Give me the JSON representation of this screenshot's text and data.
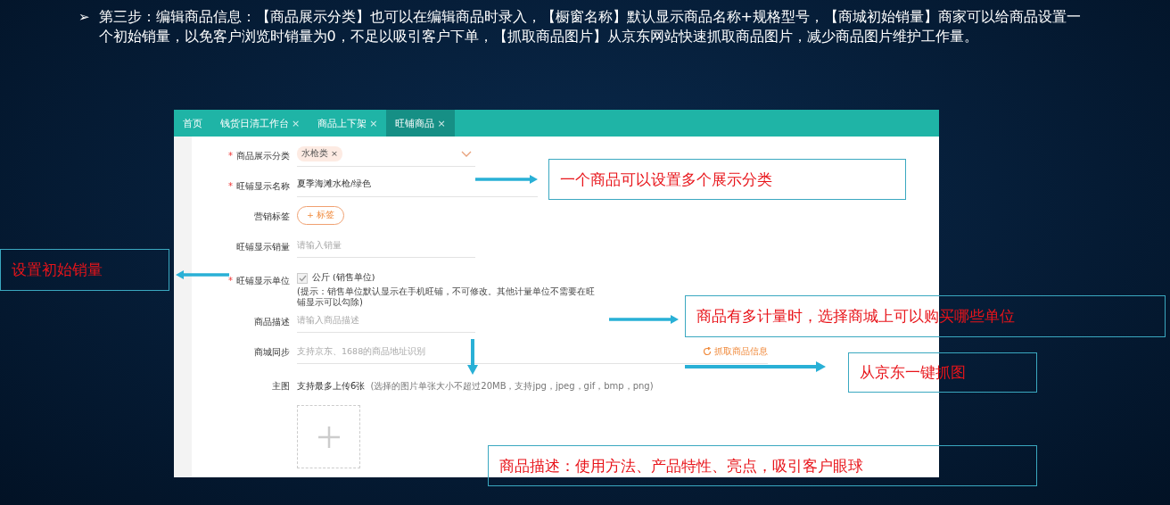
{
  "slide": {
    "bullet": "➢",
    "text": "第三步：编辑商品信息：【商品展示分类】也可以在编辑商品时录入，【橱窗名称】默认显示商品名称+规格型号，【商城初始销量】商家可以给商品设置一个初始销量，以免客户浏览时销量为0，不足以吸引客户下单，【抓取商品图片】从京东网站快速抓取商品图片，减少商品图片维护工作量。"
  },
  "app": {
    "tabs": [
      {
        "label": "首页",
        "selected": false
      },
      {
        "label": "钱货日清工作台",
        "close": "×",
        "selected": false
      },
      {
        "label": "商品上下架",
        "close": "×",
        "selected": false
      },
      {
        "label": "旺铺商品",
        "close": "×",
        "selected": true
      }
    ],
    "required_mark": "*",
    "form": [
      {
        "kind": "tag-select",
        "label": "商品展示分类",
        "required": true,
        "tag": "水枪类",
        "tag_close": "×"
      },
      {
        "kind": "text",
        "label": "旺铺显示名称",
        "required": true,
        "value": "夏季海滩水枪/绿色"
      },
      {
        "kind": "tag-button",
        "label": "营销标签",
        "required": false,
        "button": "+ 标签"
      },
      {
        "kind": "input",
        "label": "旺铺显示销量",
        "required": false,
        "placeholder": "请输入销量"
      },
      {
        "kind": "checkbox",
        "label": "旺铺显示单位",
        "required": true,
        "option": "公斤 (销售单位)",
        "checked": true,
        "hint": "(提示：销售单位默认显示在手机旺铺，不可修改。其他计量单位不需要在旺铺显示可以勾除)"
      },
      {
        "kind": "input",
        "label": "商品描述",
        "required": false,
        "placeholder": "请输入商品描述"
      },
      {
        "kind": "input-with-link",
        "label": "商城同步",
        "required": false,
        "placeholder": "支持京东、1688的商品地址识别",
        "link": "抓取商品信息"
      },
      {
        "kind": "upload",
        "label": "主图",
        "required": false,
        "value": "支持最多上传6张",
        "hint": "(选择的图片单张大小不超过20MB，支持jpg，jpeg，gif，bmp，png)"
      }
    ]
  },
  "callouts": [
    {
      "text": "一个商品可以设置多个展示分类"
    },
    {
      "text": "设置初始销量"
    },
    {
      "text": "商品有多计量时，选择商城上可以购买哪些单位"
    },
    {
      "text": "从京东一键抓图"
    },
    {
      "text": "商品描述：使用方法、产品特性、亮点，吸引客户眼球"
    }
  ]
}
